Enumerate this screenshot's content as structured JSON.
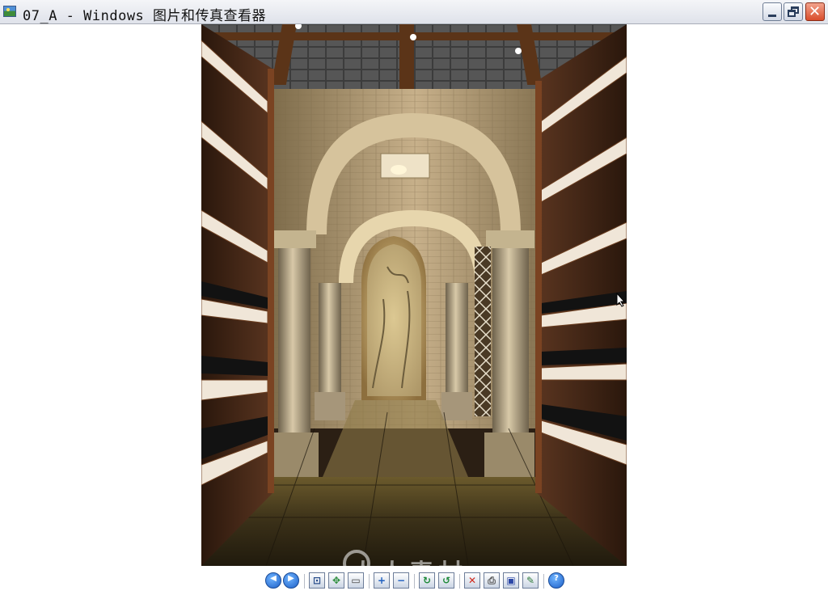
{
  "window": {
    "title": "07_A - Windows 图片和传真查看器",
    "app_icon": "image-viewer-icon",
    "controls": {
      "minimize": "minimize-icon",
      "maximize": "restore-icon",
      "close": "close-icon"
    }
  },
  "image": {
    "description_icon": "photo",
    "watermark_text": "人人素材"
  },
  "toolbar": {
    "buttons": [
      {
        "icon": "previous-image-icon",
        "glyph": "◀"
      },
      {
        "icon": "next-image-icon",
        "glyph": "▶"
      },
      {
        "icon": "best-fit-icon",
        "glyph": "⊡"
      },
      {
        "icon": "actual-size-icon",
        "glyph": "✥"
      },
      {
        "icon": "slideshow-icon",
        "glyph": "▭"
      },
      {
        "icon": "zoom-in-icon",
        "glyph": "+"
      },
      {
        "icon": "zoom-out-icon",
        "glyph": "−"
      },
      {
        "icon": "rotate-clockwise-icon",
        "glyph": "↻"
      },
      {
        "icon": "rotate-counterclockwise-icon",
        "glyph": "↺"
      },
      {
        "icon": "delete-icon",
        "glyph": "✕"
      },
      {
        "icon": "print-icon",
        "glyph": "⎙"
      },
      {
        "icon": "save-icon",
        "glyph": "▣"
      },
      {
        "icon": "edit-icon",
        "glyph": "✎"
      },
      {
        "icon": "help-icon",
        "glyph": "?"
      }
    ]
  }
}
